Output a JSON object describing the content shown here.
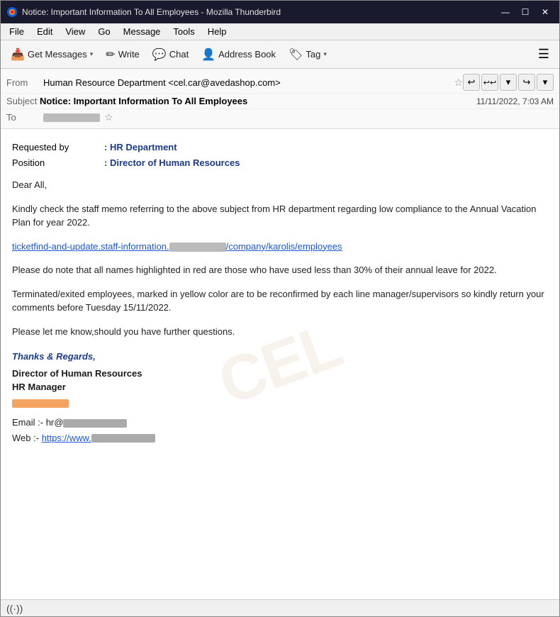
{
  "titlebar": {
    "title": "Notice: Important Information To All Employees - Mozilla Thunderbird",
    "minimize": "—",
    "maximize": "☐",
    "close": "✕"
  },
  "menubar": {
    "items": [
      "File",
      "Edit",
      "View",
      "Go",
      "Message",
      "Tools",
      "Help"
    ]
  },
  "toolbar": {
    "get_messages": "Get Messages",
    "write": "Write",
    "chat": "Chat",
    "address_book": "Address Book",
    "tag": "Tag",
    "menu_icon": "☰"
  },
  "email": {
    "from_label": "From",
    "from_value": "Human Resource Department <cel.car@avedashop.com>",
    "subject_label": "Subject",
    "subject_value": "Notice: Important Information To All Employees",
    "timestamp": "11/11/2022, 7:03 AM",
    "to_label": "To",
    "requested_by_key": "Requested by",
    "requested_by_val": ": HR Department",
    "position_key": "Position",
    "position_val": ": Director of Human Resources",
    "greeting": "Dear All,",
    "para1": "Kindly check the staff memo referring to the above subject from HR department regarding low compliance to the Annual Vacation Plan for year 2022.",
    "phish_link_text": "ticketfind-and-update.staff-information.",
    "phish_link_mid": "██████████",
    "phish_link_end": "/company/karolis/employees",
    "para2": "Please do note that all names highlighted in red are those who have used less than 30% of their annual leave for 2022.",
    "para3": "Terminated/exited employees, marked in yellow color are to be reconfirmed by each line manager/supervisors so kindly return your comments before Tuesday 15/11/2022.",
    "para4": "Please let me know,should you have further questions.",
    "sig_thanks": "Thanks & Regards,",
    "sig_title1": "Director of Human Resources",
    "sig_title2": "HR Manager",
    "sig_email_label": "Email :-",
    "sig_email": "hr@",
    "sig_web_label": "Web   :-",
    "sig_web": "https://www.",
    "watermark": "CEL"
  },
  "statusbar": {
    "wifi_label": ""
  },
  "icons": {
    "thunderbird": "🌩",
    "reply": "↩",
    "reply_all": "↩↩",
    "down_arrow": "▾",
    "forward": "↪",
    "more": "▾",
    "get_messages_icon": "📥",
    "write_icon": "✏",
    "chat_icon": "💬",
    "address_book_icon": "👤",
    "tag_icon": "🏷",
    "star": "☆",
    "wifi": "((·))"
  }
}
